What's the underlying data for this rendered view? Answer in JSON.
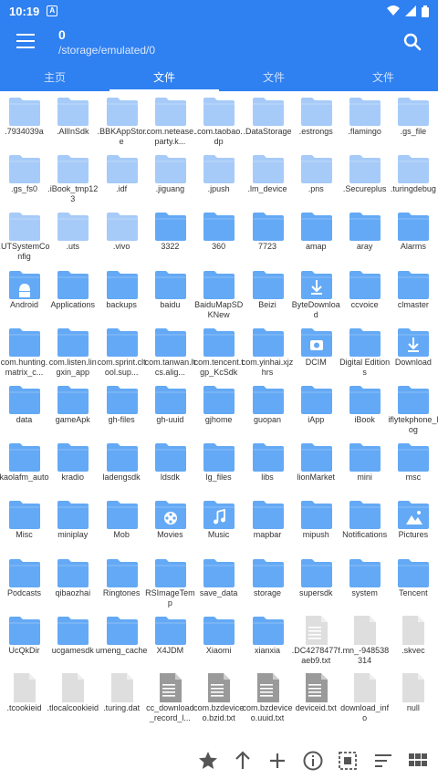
{
  "status": {
    "time": "10:19",
    "notif": "A"
  },
  "toolbar": {
    "title": "0",
    "path": "/storage/emulated/0"
  },
  "tabs": [
    "主页",
    "文件",
    "文件",
    "文件"
  ],
  "colors": {
    "accent": "#2f80f0",
    "folder": "#64a9f5",
    "folder_light": "#a7cbf8",
    "file": "#dedede",
    "file_dark": "#9a9a9a"
  },
  "items": [
    {
      "label": ".7934039a",
      "kind": "folder-light"
    },
    {
      "label": ".AllInSdk",
      "kind": "folder-light"
    },
    {
      "label": ".BBKAppStore",
      "kind": "folder-light"
    },
    {
      "label": ".com.netease.party.k...",
      "kind": "folder-light"
    },
    {
      "label": ".com.taobao.dp",
      "kind": "folder-light"
    },
    {
      "label": ".DataStorage",
      "kind": "folder-light"
    },
    {
      "label": ".estrongs",
      "kind": "folder-light"
    },
    {
      "label": ".flamingo",
      "kind": "folder-light"
    },
    {
      "label": ".gs_file",
      "kind": "folder-light"
    },
    {
      "label": ".gs_fs0",
      "kind": "folder-light"
    },
    {
      "label": ".iBook_tmp123",
      "kind": "folder-light"
    },
    {
      "label": ".idf",
      "kind": "folder-light"
    },
    {
      "label": ".jiguang",
      "kind": "folder-light"
    },
    {
      "label": ".jpush",
      "kind": "folder-light"
    },
    {
      "label": ".lm_device",
      "kind": "folder-light"
    },
    {
      "label": ".pns",
      "kind": "folder-light"
    },
    {
      "label": ".Secureplus",
      "kind": "folder-light"
    },
    {
      "label": ".turingdebug",
      "kind": "folder-light"
    },
    {
      "label": ".UTSystemConfig",
      "kind": "folder-light"
    },
    {
      "label": ".uts",
      "kind": "folder-light"
    },
    {
      "label": ".vivo",
      "kind": "folder-light"
    },
    {
      "label": "3322",
      "kind": "folder"
    },
    {
      "label": "360",
      "kind": "folder"
    },
    {
      "label": "7723",
      "kind": "folder"
    },
    {
      "label": "amap",
      "kind": "folder"
    },
    {
      "label": "aray",
      "kind": "folder"
    },
    {
      "label": "Alarms",
      "kind": "folder"
    },
    {
      "label": "Android",
      "kind": "folder-android"
    },
    {
      "label": "Applications",
      "kind": "folder"
    },
    {
      "label": "backups",
      "kind": "folder"
    },
    {
      "label": "baidu",
      "kind": "folder"
    },
    {
      "label": "BaiduMapSDKNew",
      "kind": "folder"
    },
    {
      "label": "Beizi",
      "kind": "folder"
    },
    {
      "label": "ByteDownload",
      "kind": "folder-download"
    },
    {
      "label": "ccvoice",
      "kind": "folder"
    },
    {
      "label": "clmaster",
      "kind": "folder"
    },
    {
      "label": "com.hunting.matrix_c...",
      "kind": "folder"
    },
    {
      "label": "com.listen.lingxin_app",
      "kind": "folder"
    },
    {
      "label": "com.sprint.cltool.sup...",
      "kind": "folder"
    },
    {
      "label": "com.tanwan.ltcs.alig...",
      "kind": "folder"
    },
    {
      "label": "com.tencent.tgp_KcSdk",
      "kind": "folder"
    },
    {
      "label": "com.yinhai.xjzhrs",
      "kind": "folder"
    },
    {
      "label": "DCIM",
      "kind": "folder-camera"
    },
    {
      "label": "Digital Editions",
      "kind": "folder"
    },
    {
      "label": "Download",
      "kind": "folder-download"
    },
    {
      "label": "data",
      "kind": "folder"
    },
    {
      "label": "gameApk",
      "kind": "folder"
    },
    {
      "label": "gh-files",
      "kind": "folder"
    },
    {
      "label": "gh-uuid",
      "kind": "folder"
    },
    {
      "label": "gjhome",
      "kind": "folder"
    },
    {
      "label": "guopan",
      "kind": "folder"
    },
    {
      "label": "iApp",
      "kind": "folder"
    },
    {
      "label": "iBook",
      "kind": "folder"
    },
    {
      "label": "iflytekphone_log",
      "kind": "folder"
    },
    {
      "label": "kaolafm_auto",
      "kind": "folder"
    },
    {
      "label": "kradio",
      "kind": "folder"
    },
    {
      "label": "ladengsdk",
      "kind": "folder"
    },
    {
      "label": "ldsdk",
      "kind": "folder"
    },
    {
      "label": "lg_files",
      "kind": "folder"
    },
    {
      "label": "libs",
      "kind": "folder"
    },
    {
      "label": "lionMarket",
      "kind": "folder"
    },
    {
      "label": "mini",
      "kind": "folder"
    },
    {
      "label": "msc",
      "kind": "folder"
    },
    {
      "label": "Misc",
      "kind": "folder"
    },
    {
      "label": "miniplay",
      "kind": "folder"
    },
    {
      "label": "Mob",
      "kind": "folder"
    },
    {
      "label": "Movies",
      "kind": "folder-movie"
    },
    {
      "label": "Music",
      "kind": "folder-music"
    },
    {
      "label": "mapbar",
      "kind": "folder"
    },
    {
      "label": "mipush",
      "kind": "folder"
    },
    {
      "label": "Notifications",
      "kind": "folder"
    },
    {
      "label": "Pictures",
      "kind": "folder-picture"
    },
    {
      "label": "Podcasts",
      "kind": "folder"
    },
    {
      "label": "qibaozhai",
      "kind": "folder"
    },
    {
      "label": "Ringtones",
      "kind": "folder"
    },
    {
      "label": "RSImageTemp",
      "kind": "folder"
    },
    {
      "label": "save_data",
      "kind": "folder"
    },
    {
      "label": "storage",
      "kind": "folder"
    },
    {
      "label": "supersdk",
      "kind": "folder"
    },
    {
      "label": "system",
      "kind": "folder"
    },
    {
      "label": "Tencent",
      "kind": "folder"
    },
    {
      "label": "UcQkDir",
      "kind": "folder"
    },
    {
      "label": "ucgamesdk",
      "kind": "folder"
    },
    {
      "label": "umeng_cache",
      "kind": "folder"
    },
    {
      "label": "X4JDM",
      "kind": "folder"
    },
    {
      "label": "Xiaomi",
      "kind": "folder"
    },
    {
      "label": "xianxia",
      "kind": "folder"
    },
    {
      "label": ".DC4278477faeb9.txt",
      "kind": "file-text"
    },
    {
      "label": ".mn_-948538314",
      "kind": "file"
    },
    {
      "label": ".skvec",
      "kind": "file"
    },
    {
      "label": ".tcookieid",
      "kind": "file"
    },
    {
      "label": ".tlocalcookieid",
      "kind": "file"
    },
    {
      "label": ".turing.dat",
      "kind": "file"
    },
    {
      "label": "cc_download_record_l...",
      "kind": "file-text-dark"
    },
    {
      "label": "com.bzdeviceo.bzid.txt",
      "kind": "file-text-dark"
    },
    {
      "label": "com.bzdeviceo.uuid.txt",
      "kind": "file-text-dark"
    },
    {
      "label": "deviceid.txt",
      "kind": "file-text-dark"
    },
    {
      "label": "download_info",
      "kind": "file"
    },
    {
      "label": "null",
      "kind": "file"
    }
  ],
  "bottom_bar": [
    "star-icon",
    "arrow-up-icon",
    "plus-icon",
    "info-icon",
    "select-icon",
    "sort-icon",
    "grid-view-icon"
  ]
}
